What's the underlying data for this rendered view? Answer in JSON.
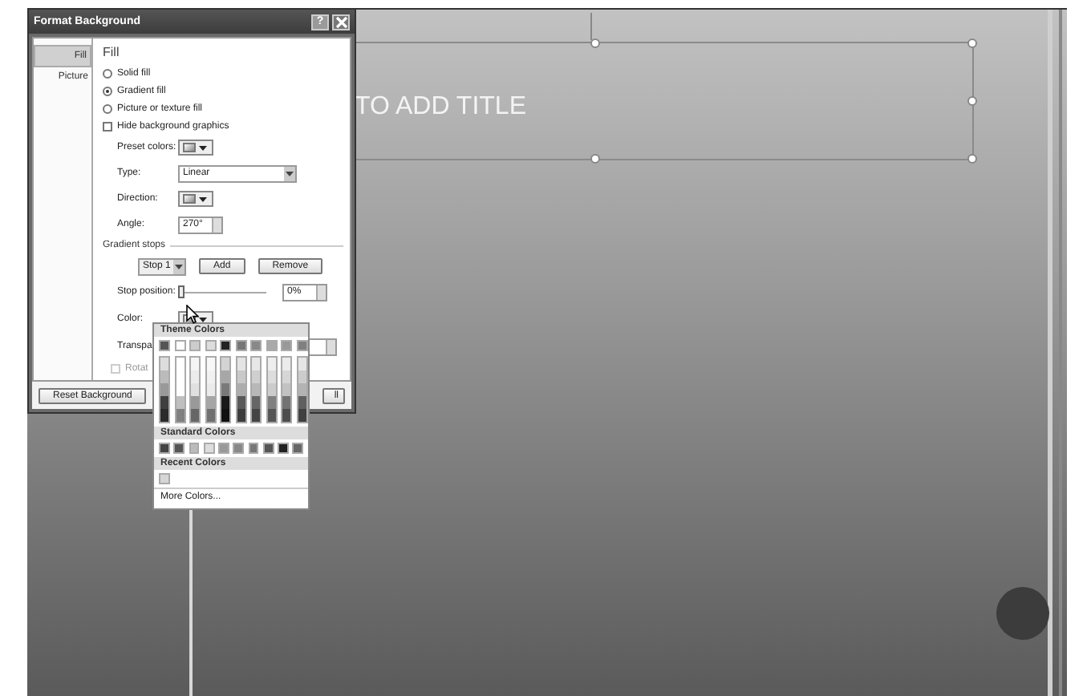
{
  "slide": {
    "title_text": "TO ADD TITLE"
  },
  "dialog": {
    "title": "Format Background",
    "help": "?",
    "tabs": [
      {
        "label": "Fill",
        "selected": true
      },
      {
        "label": "Picture",
        "selected": false
      }
    ],
    "heading": "Fill",
    "fill_options": [
      {
        "label": "Solid fill",
        "selected": false
      },
      {
        "label": "Gradient fill",
        "selected": true
      },
      {
        "label": "Picture or texture fill",
        "selected": false
      }
    ],
    "hide_graphics": {
      "label": "Hide background graphics",
      "checked": false
    },
    "preset_label": "Preset colors:",
    "type_label": "Type:",
    "type_value": "Linear",
    "direction_label": "Direction:",
    "angle_label": "Angle:",
    "angle_value": "270°",
    "stops_heading": "Gradient stops",
    "stop_value": "Stop 1",
    "add": "Add",
    "remove": "Remove",
    "position_label": "Stop position:",
    "position": {
      "level": 0
    },
    "position_value": "0%",
    "color_label": "Color:",
    "transparency_label": "Transpa",
    "rotate": {
      "label": "Rotat",
      "checked": false,
      "disabled": true
    },
    "reset": "Reset Background",
    "apply": "ll"
  },
  "palette": {
    "theme_heading": "Theme Colors",
    "theme_colors": [
      {
        "color": "#555555"
      },
      {
        "color": "#ffffff"
      },
      {
        "color": "#cccccc"
      },
      {
        "color": "#dddddd"
      },
      {
        "color": "#222222"
      },
      {
        "color": "#777777"
      },
      {
        "color": "#888888"
      },
      {
        "color": "#aaaaaa"
      },
      {
        "color": "#999999"
      },
      {
        "color": "#808080"
      }
    ],
    "standard_heading": "Standard Colors",
    "standard_colors": [
      {
        "color": "#444444"
      },
      {
        "color": "#555555"
      },
      {
        "color": "#bbbbbb"
      },
      {
        "color": "#dddddd"
      },
      {
        "color": "#999999"
      },
      {
        "color": "#888888"
      },
      {
        "color": "#777777"
      },
      {
        "color": "#555555"
      },
      {
        "color": "#222222"
      },
      {
        "color": "#666666"
      }
    ],
    "recent_heading": "Recent Colors",
    "recent_colors": [
      {
        "color": "#d6d6d6"
      }
    ],
    "more": "More Colors..."
  }
}
